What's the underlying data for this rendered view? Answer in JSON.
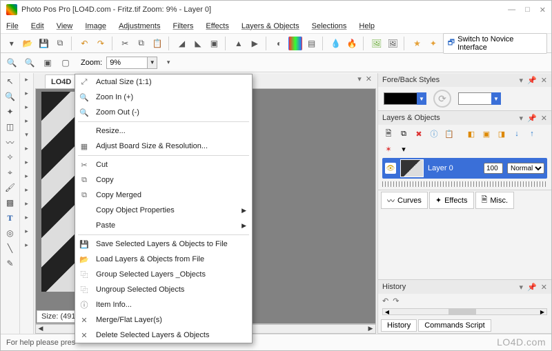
{
  "title": "Photo Pos Pro  [LO4D.com - Fritz.tif Zoom: 9% - Layer 0]",
  "menus": [
    "File",
    "Edit",
    "View",
    "Image",
    "Adjustments",
    "Filters",
    "Effects",
    "Layers & Objects",
    "Selections",
    "Help"
  ],
  "toolbar": {
    "switch_label": "Switch to Novice Interface"
  },
  "zoom": {
    "label": "Zoom:",
    "value": "9%"
  },
  "document": {
    "tab": "LO4D",
    "size_label": "Size: (491…"
  },
  "ctx": {
    "items": [
      {
        "icon": "⤢",
        "label": "Actual Size (1:1)"
      },
      {
        "icon": "🔍",
        "label": "Zoon In (+)"
      },
      {
        "icon": "🔍",
        "label": "Zoom Out (-)"
      },
      {
        "sep": true
      },
      {
        "icon": "",
        "label": "Resize..."
      },
      {
        "icon": "▦",
        "label": "Adjust Board  Size & Resolution..."
      },
      {
        "sep": true
      },
      {
        "icon": "✂",
        "label": "Cut"
      },
      {
        "icon": "⧉",
        "label": "Copy"
      },
      {
        "icon": "⧉",
        "label": "Copy Merged"
      },
      {
        "icon": "",
        "label": "Copy Object Properties",
        "sub": true
      },
      {
        "icon": "",
        "label": "Paste",
        "sub": true
      },
      {
        "sep": true
      },
      {
        "icon": "💾",
        "label": "Save Selected Layers & Objects to File"
      },
      {
        "icon": "📂",
        "label": "Load Layers & Objects from File"
      },
      {
        "icon": "⿻",
        "label": "Group Selected Layers _Objects"
      },
      {
        "icon": "⿻",
        "label": "Ungroup Selected Objects"
      },
      {
        "icon": "ⓘ",
        "label": "Item Info..."
      },
      {
        "icon": "✕",
        "label": "Merge/Flat Layer(s)"
      },
      {
        "icon": "✕",
        "label": "Delete Selected Layers & Objects"
      }
    ]
  },
  "panels": {
    "forestyles": {
      "title": "Fore/Back Styles"
    },
    "layers": {
      "title": "Layers & Objects",
      "layer_name": "Layer 0",
      "opacity": "100",
      "blend": "Normal"
    },
    "tabs": [
      "Curves",
      "Effects",
      "Misc."
    ],
    "history": {
      "title": "History",
      "tabs": [
        "History",
        "Commands Script"
      ]
    }
  },
  "status": "For help please pres",
  "watermark": "LO4D.com"
}
